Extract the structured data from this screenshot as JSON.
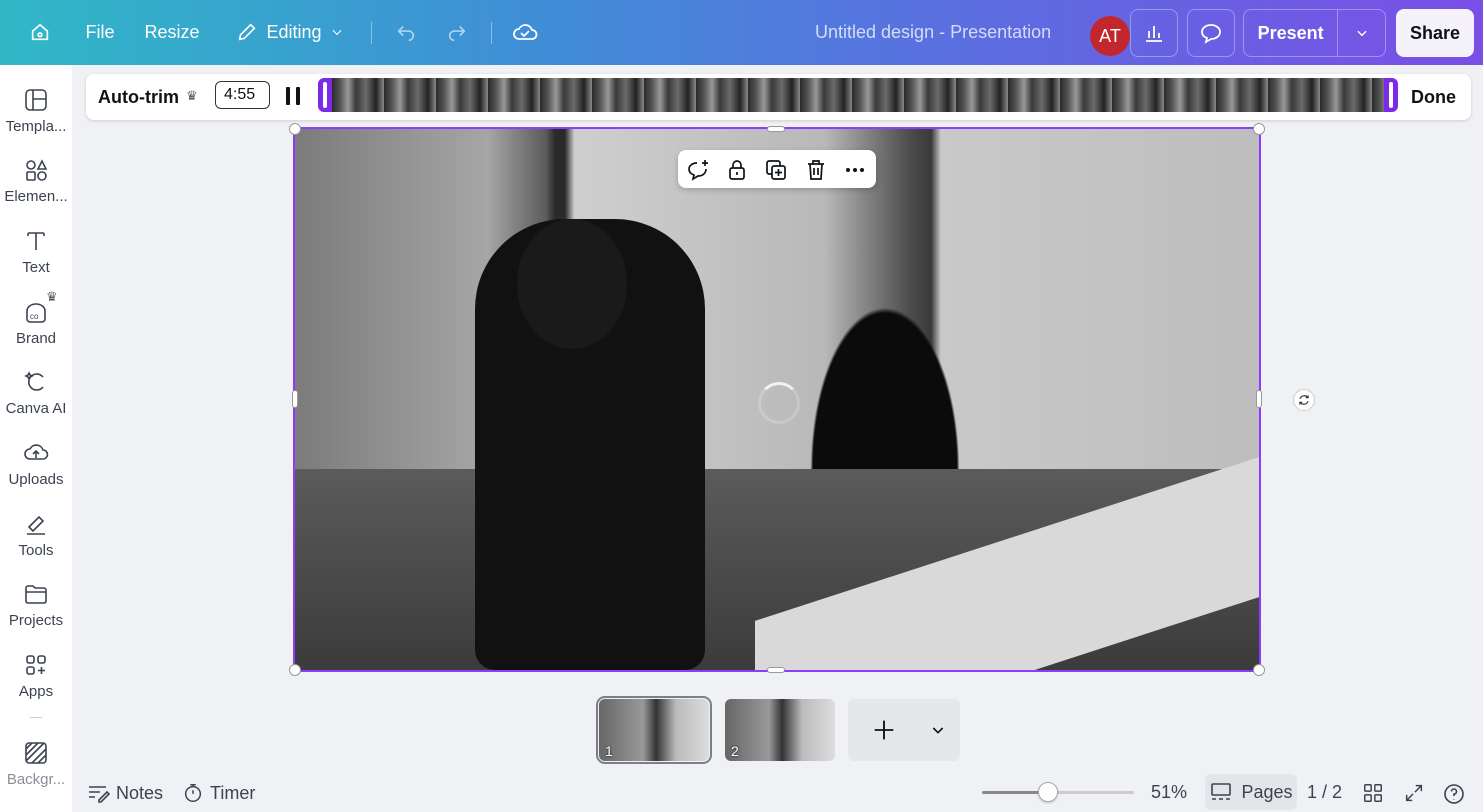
{
  "topbar": {
    "file_label": "File",
    "resize_label": "Resize",
    "editing_label": "Editing",
    "doc_title": "Untitled design - Presentation",
    "avatar_initials": "AT",
    "present_label": "Present",
    "share_label": "Share"
  },
  "sidebar": {
    "items": [
      {
        "label": "Templa...",
        "icon": "templates-icon"
      },
      {
        "label": "Elemen...",
        "icon": "elements-icon"
      },
      {
        "label": "Text",
        "icon": "text-icon"
      },
      {
        "label": "Brand",
        "icon": "brand-icon"
      },
      {
        "label": "Canva AI",
        "icon": "canva-ai-icon"
      },
      {
        "label": "Uploads",
        "icon": "uploads-icon"
      },
      {
        "label": "Tools",
        "icon": "tools-icon"
      },
      {
        "label": "Projects",
        "icon": "projects-icon"
      },
      {
        "label": "Apps",
        "icon": "apps-icon"
      },
      {
        "label": "Backgr...",
        "icon": "background-icon"
      }
    ]
  },
  "trimbar": {
    "autotrim_label": "Auto-trim",
    "time_value": "4:55",
    "done_label": "Done"
  },
  "pages": {
    "thumbs": [
      {
        "number": "1",
        "active": true
      },
      {
        "number": "2",
        "active": false
      }
    ],
    "current": "1 / 2"
  },
  "bottombar": {
    "notes_label": "Notes",
    "timer_label": "Timer",
    "zoom_level": "51%",
    "zoom_fraction": 0.51,
    "pages_label": "Pages",
    "page_counter": "1 / 2"
  },
  "colors": {
    "accent": "#8b3dff",
    "avatar_bg": "#c3272e"
  }
}
